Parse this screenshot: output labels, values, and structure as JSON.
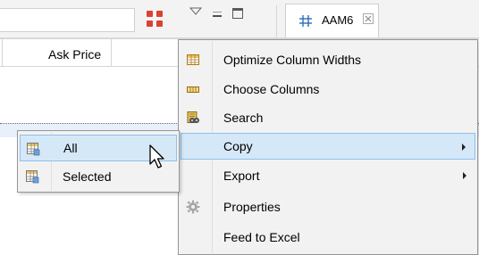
{
  "tab": {
    "label": "AAM6",
    "icon": "hash-icon"
  },
  "grid": {
    "column_header": "Ask Price"
  },
  "context_menu": {
    "items": [
      {
        "label": "Optimize Column Widths",
        "icon": "table-columns-icon"
      },
      {
        "label": "Choose Columns",
        "icon": "column-bar-icon"
      },
      {
        "label": "Search",
        "icon": "search-binoculars-icon"
      },
      {
        "label": "Copy",
        "icon": "",
        "submenu": true,
        "highlighted": true
      },
      {
        "label": "Export",
        "icon": "",
        "submenu": true
      },
      {
        "label": "Properties",
        "icon": "gear-icon"
      },
      {
        "label": "Feed to Excel",
        "icon": ""
      }
    ]
  },
  "copy_submenu": {
    "items": [
      {
        "label": "All",
        "icon": "table-icon",
        "highlighted": true
      },
      {
        "label": "Selected",
        "icon": "table-icon"
      }
    ]
  },
  "colors": {
    "highlight_bg": "#d5e8f8",
    "highlight_border": "#8cc0ef",
    "accent_red": "#d9432f",
    "tab_icon": "#2a6fb8"
  }
}
